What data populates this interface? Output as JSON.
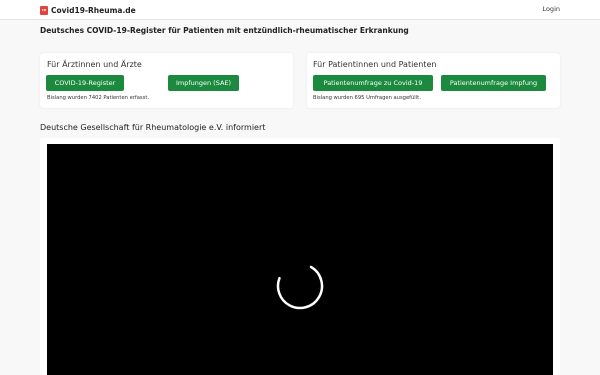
{
  "navbar": {
    "logo_text": "CR",
    "brand": "Covid19-Rheuma.de",
    "login": "Login"
  },
  "page_title": "Deutsches COVID-19-Register für Patienten mit entzündlich-rheumatischer Erkrankung",
  "doctors_card": {
    "title": "Für Ärztinnen und Ärzte",
    "buttons": [
      "COVID-19-Register",
      "Impfungen (SAE)"
    ],
    "note": "Bislang wurden 7402 Patienten erfasst."
  },
  "patients_card": {
    "title": "Für Patientinnen und Patienten",
    "buttons": [
      "Patientenumfrage zu Covid-19",
      "Patientenumfrage Impfung"
    ],
    "note": "Bislang wurden 695 Umfragen ausgefüllt."
  },
  "video_section": {
    "title": "Deutsche Gesellschaft für Rheumatologie e.V. informiert"
  },
  "colors": {
    "accent_green": "#1b8a3e",
    "brand_red": "#e2433a"
  }
}
